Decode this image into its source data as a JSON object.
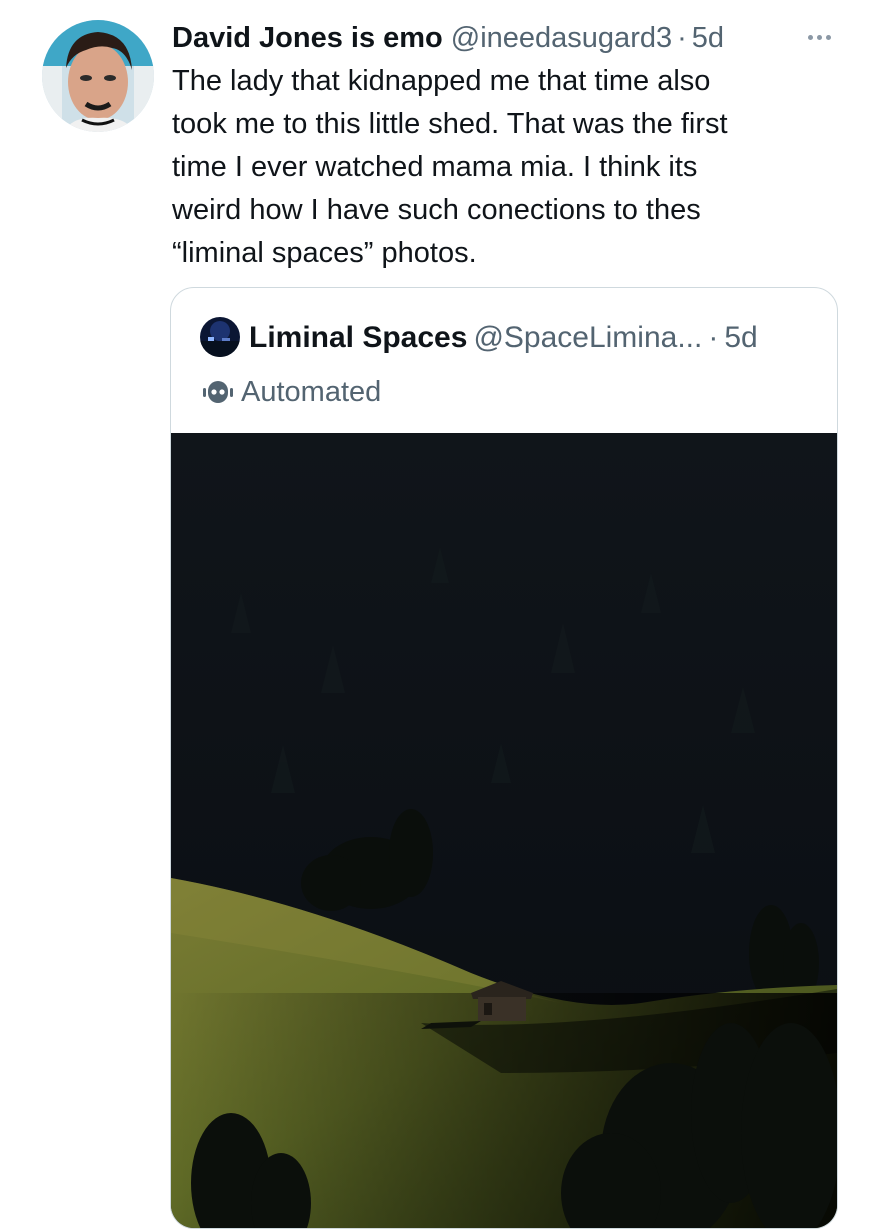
{
  "tweet": {
    "author": {
      "display_name": "David Jones is emo",
      "handle": "@ineedasugard3",
      "separator": "·",
      "time": "5d"
    },
    "more_icon": "more-horizontal-icon",
    "text_lines": [
      "The lady that kidnapped me that time also",
      "took me to this little shed. That was the first",
      "time I ever watched mama mia. I think its",
      "weird how I have such conections to thes",
      "“liminal spaces” photos."
    ]
  },
  "quote": {
    "author": {
      "display_name": "Liminal Spaces",
      "handle": "@SpaceLimina...",
      "separator": "·",
      "time": "5d"
    },
    "label": {
      "icon": "robot-icon",
      "text": "Automated"
    },
    "media": {
      "description_icon": "photo"
    }
  },
  "colors": {
    "text_primary": "#0f1419",
    "text_secondary": "#536471",
    "border": "#cfd9de"
  }
}
